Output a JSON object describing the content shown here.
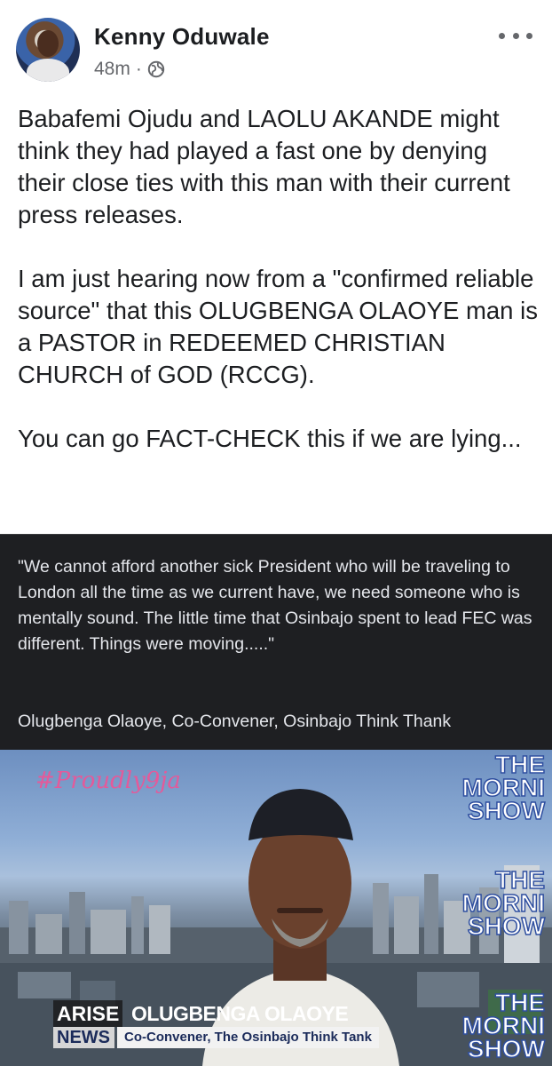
{
  "post": {
    "author": "Kenny Oduwale",
    "time": "48m",
    "separator": "·",
    "paragraphs": [
      "Babafemi Ojudu and LAOLU AKANDE might think they had played a fast one by denying their close ties with this man with their current press releases.",
      "I am just hearing now from a \"confirmed reliable source\" that this OLUGBENGA OLAOYE man is a PASTOR in REDEEMED CHRISTIAN CHURCH of GOD (RCCG).",
      "You can go FACT-CHECK this if we are lying..."
    ]
  },
  "quote": {
    "text": "\"We cannot afford another sick President who will be traveling to London all the time as we current have, we need someone who is mentally sound. The little time that Osinbajo spent to lead FEC was different. Things were moving.....\"",
    "attribution": "Olugbenga Olaoye, Co-Convener, Osinbajo Think Thank"
  },
  "video": {
    "hashtag": "#Proudly9ja",
    "brand_lines": [
      "THE",
      "MORNI",
      "SHOW"
    ],
    "lower_third": {
      "arise": "ARISE",
      "news": "NEWS",
      "name": "OLUGBENGA OLAOYE",
      "title": "Co-Convener, The Osinbajo Think Tank"
    }
  },
  "icons": {
    "more": "more-options-icon",
    "privacy": "globe-icon"
  },
  "colors": {
    "name_text": "#1c1e21",
    "meta_text": "#65676b",
    "quote_bg": "#1e1f22",
    "quote_text": "#e4e6eb",
    "hashtag": "#e45a9a"
  }
}
